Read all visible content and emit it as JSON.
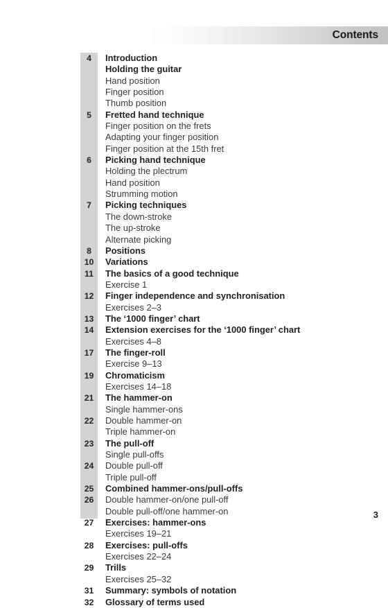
{
  "header": {
    "title": "Contents"
  },
  "folio": {
    "page_number": "3"
  },
  "toc": {
    "rows": [
      {
        "num": "4",
        "label": "Introduction",
        "bold": true
      },
      {
        "num": "",
        "label": "Holding the guitar",
        "bold": true
      },
      {
        "num": "",
        "label": "Hand position",
        "bold": false
      },
      {
        "num": "",
        "label": "Finger position",
        "bold": false
      },
      {
        "num": "",
        "label": "Thumb position",
        "bold": false
      },
      {
        "num": "5",
        "label": "Fretted hand technique",
        "bold": true
      },
      {
        "num": "",
        "label": "Finger position on the frets",
        "bold": false
      },
      {
        "num": "",
        "label": "Adapting your finger position",
        "bold": false
      },
      {
        "num": "",
        "label": "Finger position at the 15th fret",
        "bold": false
      },
      {
        "num": "6",
        "label": "Picking hand technique",
        "bold": true
      },
      {
        "num": "",
        "label": "Holding the plectrum",
        "bold": false
      },
      {
        "num": "",
        "label": "Hand position",
        "bold": false
      },
      {
        "num": "",
        "label": "Strumming motion",
        "bold": false
      },
      {
        "num": "7",
        "label": "Picking techniques",
        "bold": true
      },
      {
        "num": "",
        "label": "The down-stroke",
        "bold": false
      },
      {
        "num": "",
        "label": "The up-stroke",
        "bold": false
      },
      {
        "num": "",
        "label": "Alternate picking",
        "bold": false
      },
      {
        "num": "8",
        "label": "Positions",
        "bold": true
      },
      {
        "num": "10",
        "label": "Variations",
        "bold": true
      },
      {
        "num": "11",
        "label": "The basics of a good technique",
        "bold": true
      },
      {
        "num": "",
        "label": "Exercise 1",
        "bold": false
      },
      {
        "num": "12",
        "label": "Finger independence and synchronisation",
        "bold": true
      },
      {
        "num": "",
        "label": "Exercises 2–3",
        "bold": false
      },
      {
        "num": "13",
        "label": "The ‘1000 finger’ chart",
        "bold": true
      },
      {
        "num": "14",
        "label": "Extension exercises for the ‘1000 finger’ chart",
        "bold": true
      },
      {
        "num": "",
        "label": "Exercises 4–8",
        "bold": false
      },
      {
        "num": "17",
        "label": "The finger-roll",
        "bold": true
      },
      {
        "num": "",
        "label": "Exercise 9–13",
        "bold": false
      },
      {
        "num": "19",
        "label": "Chromaticism",
        "bold": true
      },
      {
        "num": "",
        "label": "Exercises 14–18",
        "bold": false
      },
      {
        "num": "21",
        "label": "The hammer-on",
        "bold": true
      },
      {
        "num": "",
        "label": "Single hammer-ons",
        "bold": false
      },
      {
        "num": "22",
        "label": "Double hammer-on",
        "bold": false
      },
      {
        "num": "",
        "label": "Triple hammer-on",
        "bold": false
      },
      {
        "num": "23",
        "label": "The pull-off",
        "bold": true
      },
      {
        "num": "",
        "label": "Single pull-offs",
        "bold": false
      },
      {
        "num": "24",
        "label": "Double pull-off",
        "bold": false
      },
      {
        "num": "",
        "label": "Triple pull-off",
        "bold": false
      },
      {
        "num": "25",
        "label": "Combined hammer-ons/pull-offs",
        "bold": true
      },
      {
        "num": "26",
        "label": "Double hammer-on/one pull-off",
        "bold": false
      },
      {
        "num": "",
        "label": "Double pull-off/one hammer-on",
        "bold": false
      },
      {
        "num": "27",
        "label": "Exercises: hammer-ons",
        "bold": true
      },
      {
        "num": "",
        "label": "Exercises 19–21",
        "bold": false
      },
      {
        "num": "28",
        "label": "Exercises: pull-offs",
        "bold": true
      },
      {
        "num": "",
        "label": "Exercises 22–24",
        "bold": false
      },
      {
        "num": "29",
        "label": "Trills",
        "bold": true
      },
      {
        "num": "",
        "label": "Exercises 25–32",
        "bold": false
      },
      {
        "num": "31",
        "label": "Summary: symbols of notation",
        "bold": true
      },
      {
        "num": "32",
        "label": "Glossary of terms used",
        "bold": true
      }
    ]
  }
}
